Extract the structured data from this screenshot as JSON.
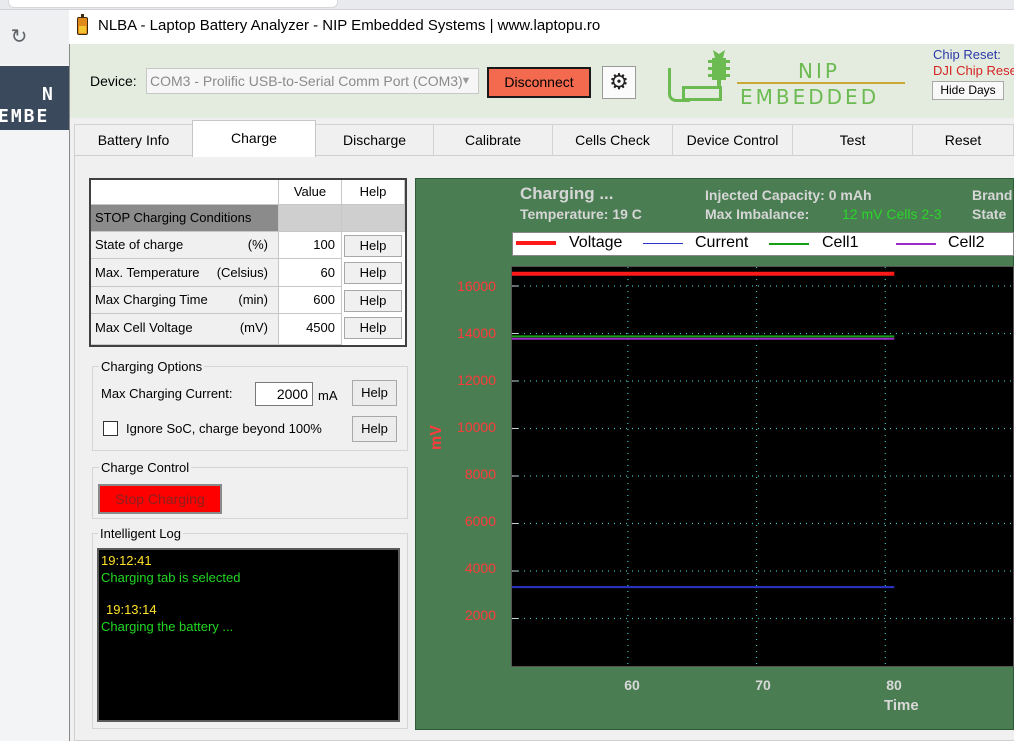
{
  "window": {
    "title": "NLBA - Laptop Battery Analyzer - NIP Embedded Systems | www.laptopu.ro"
  },
  "background_page": {
    "banner_line1": "N",
    "banner_line2": "EMBE"
  },
  "header": {
    "device_label": "Device:",
    "device_value": "COM3 - Prolific USB-to-Serial Comm Port (COM3)",
    "disconnect_label": "Disconnect",
    "logo_nip": "NIP",
    "logo_embedded": "EMBEDDED",
    "chip_reset_label": "Chip Reset:",
    "dji_chip_reset": "DJI Chip Rese",
    "hide_days_label": "Hide Days"
  },
  "tabs": [
    {
      "label": "Battery Info",
      "active": false
    },
    {
      "label": "Charge",
      "active": true
    },
    {
      "label": "Discharge",
      "active": false
    },
    {
      "label": "Calibrate",
      "active": false
    },
    {
      "label": "Cells Check",
      "active": false
    },
    {
      "label": "Device Control",
      "active": false
    },
    {
      "label": "Test",
      "active": false
    },
    {
      "label": "Reset",
      "active": false
    }
  ],
  "conditions": {
    "col_value": "Value",
    "col_help": "Help",
    "section": "STOP Charging Conditions",
    "rows": [
      {
        "name": "State of charge",
        "unit": "(%)",
        "value": "100",
        "help": "Help"
      },
      {
        "name": "Max. Temperature",
        "unit": "(Celsius)",
        "value": "60",
        "help": "Help"
      },
      {
        "name": "Max Charging Time",
        "unit": "(min)",
        "value": "600",
        "help": "Help"
      },
      {
        "name": "Max Cell Voltage",
        "unit": "(mV)",
        "value": "4500",
        "help": "Help"
      }
    ]
  },
  "charging_options": {
    "title": "Charging Options",
    "max_current_label": "Max Charging Current:",
    "max_current_value": "2000",
    "max_current_unit": "mA",
    "help": "Help",
    "ignore_soc_label": "Ignore SoC, charge beyond 100%",
    "ignore_soc_checked": false
  },
  "charge_control": {
    "title": "Charge Control",
    "stop_label": "Stop Charging"
  },
  "log": {
    "title": "Intelligent Log",
    "entries": [
      {
        "time": "19:12:41",
        "text": "Charging tab is selected"
      },
      {
        "time": "19:13:14",
        "text": "Charging the battery ..."
      }
    ]
  },
  "chart_header": {
    "status": "Charging ...",
    "temperature": "Temperature:  19 C",
    "injected": "Injected Capacity:  0 mAh",
    "imbalance_label": "Max Imbalance:",
    "imbalance_value": "12 mV Cells 2-3",
    "brand": "Brand",
    "state": "State"
  },
  "colors": {
    "voltage": "#ff1a1a",
    "current": "#2a35c8",
    "cell1": "#14a014",
    "cell2": "#9b2ac8",
    "grid": "#3fbfbf"
  },
  "chart_data": {
    "type": "line",
    "ylabel": "mV",
    "xlabel": "Time",
    "xlim": [
      51,
      90
    ],
    "ylim": [
      0,
      16800
    ],
    "yticks": [
      2000,
      4000,
      6000,
      8000,
      10000,
      12000,
      14000,
      16000
    ],
    "xticks": [
      60,
      70,
      80
    ],
    "series": [
      {
        "name": "Voltage",
        "color": "#ff1a1a",
        "x": [
          51,
          80.7
        ],
        "y": [
          16520,
          16520
        ]
      },
      {
        "name": "Current",
        "color": "#2a35c8",
        "x": [
          51,
          80.7
        ],
        "y": [
          3320,
          3320
        ]
      },
      {
        "name": "Cell1",
        "color": "#14a014",
        "x": [
          51,
          80.7
        ],
        "y": [
          13880,
          13880
        ]
      },
      {
        "name": "Cell2",
        "color": "#9b2ac8",
        "x": [
          51,
          80.7
        ],
        "y": [
          13780,
          13780
        ]
      }
    ]
  }
}
